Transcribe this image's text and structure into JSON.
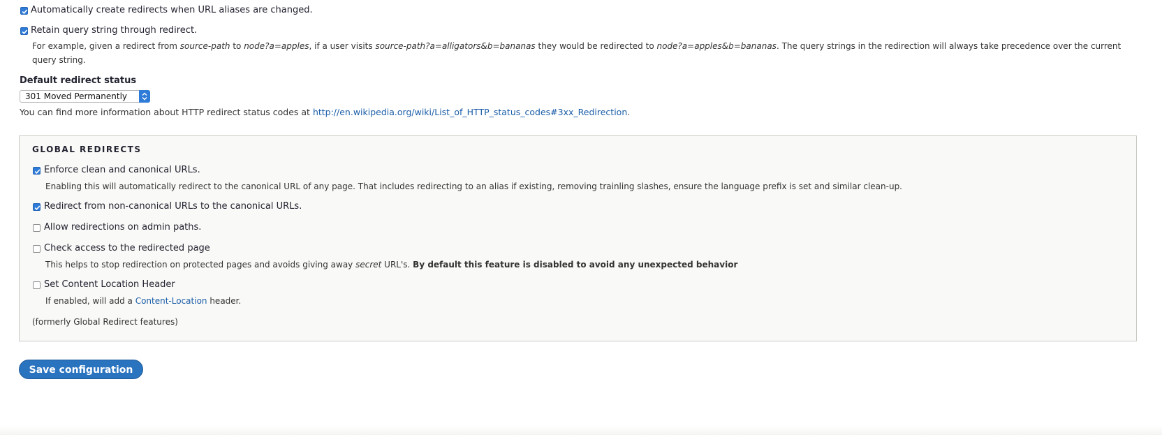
{
  "settings": {
    "auto_redirect_label": "Automatically create redirects when URL aliases are changed.",
    "retain_query_label": "Retain query string through redirect.",
    "retain_query_desc": {
      "p1": "For example, given a redirect from ",
      "i1": "source-path",
      "p2": " to ",
      "i2": "node?a=apples",
      "p3": ", if a user visits ",
      "i3": "source-path?a=alligators&b=bananas",
      "p4": " they would be redirected to ",
      "i4": "node?a=apples&b=bananas",
      "p5": ". The query strings in the redirection will always take precedence over the current query string."
    },
    "default_status_title": "Default redirect status",
    "default_status_value": "301 Moved Permanently",
    "status_info_text": "You can find more information about HTTP redirect status codes at ",
    "status_info_link": "http://en.wikipedia.org/wiki/List_of_HTTP_status_codes#3xx_Redirection",
    "status_info_end": "."
  },
  "global": {
    "legend": "GLOBAL REDIRECTS",
    "enforce_label": "Enforce clean and canonical URLs.",
    "enforce_desc": "Enabling this will automatically redirect to the canonical URL of any page. That includes redirecting to an alias if existing, removing trainling slashes, ensure the language prefix is set and similar clean-up.",
    "noncanonical_label": "Redirect from non-canonical URLs to the canonical URLs.",
    "admin_label": "Allow redirections on admin paths.",
    "access_label": "Check access to the redirected page",
    "access_desc_p1": "This helps to stop redirection on protected pages and avoids giving away ",
    "access_desc_i": "secret",
    "access_desc_p2": " URL's. ",
    "access_desc_b": "By default this feature is disabled to avoid any unexpected behavior",
    "content_location_label": "Set Content Location Header",
    "content_location_desc_p1": "If enabled, will add a ",
    "content_location_desc_link": "Content-Location",
    "content_location_desc_p2": " header.",
    "formerly_text": "(formerly Global Redirect features)"
  },
  "checkbox_states": {
    "auto_redirect": true,
    "retain_query": true,
    "enforce": true,
    "noncanonical": true,
    "admin": false,
    "access": false,
    "content_location": false
  },
  "actions": {
    "save_label": "Save configuration"
  },
  "colors": {
    "accent": "#2f7bd8",
    "link": "#1a5da8",
    "button": "#2a73bf",
    "fieldset_bg": "#f9f9f7"
  }
}
